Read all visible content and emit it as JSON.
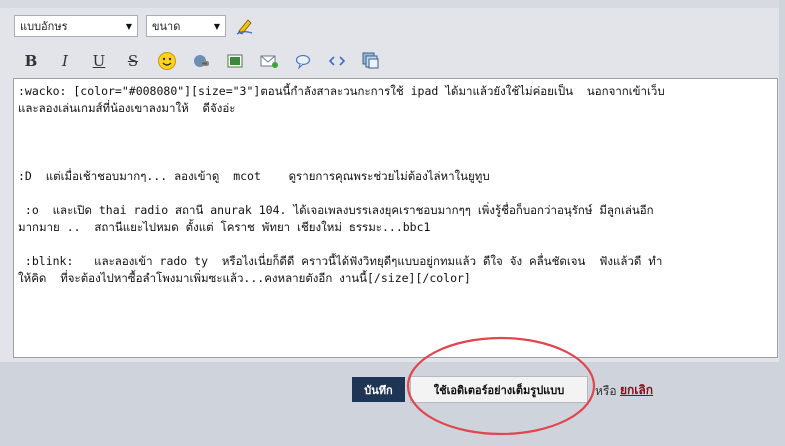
{
  "toolbar": {
    "font_select": "แบบอักษร",
    "size_select": "ขนาด",
    "bold": "B",
    "italic": "I",
    "underline": "U",
    "strike": "S"
  },
  "editor": {
    "lines": [
      ":wacko: [color=\"#008080\"][size=\"3\"]ตอนนี้กำลังสาละวนกะการใช้ ipad ได้มาแล้วยังใช้ไม่ค่อยเป็น  นอกจากเข้าเว็บ",
      "และลองเล่นเกมส์ที่น้องเขาลงมาให้  ดีจังอ่ะ",
      "",
      "",
      "",
      ":D  แต่เมื่อเช้าชอบมากๆ... ลองเข้าดู  mcot    ดูรายการคุณพระช่วยไม่ต้องไล่หาในยูทูบ",
      "",
      " :o  และเปิด thai radio สถานี anurak 104. ได้เจอเพลงบรรเลงยุคเราชอบมากๆๆ เพิ่งรู้ชื่อก็บอกว่าอนุรักษ์ มีลูกเล่นอีก",
      "มากมาย ..  สถานีแยะไปหมด ตั้งแต่ โคราช พัทยา เชียงใหม่ ธรรมะ...bbc1",
      "",
      " :blink:   และลองเข้า rado ty  หรือไงเนี่ยก็ดีดี คราวนี้ได้ฟังวิทยุดีๆแบบอยู่กทมแล้ว ดีใจ จัง คลื่นชัดเจน  ฟังแล้วดี ทำ",
      "ให้คิด  ที่จะต้องไปหาซื้อลำโพงมาเพิ่มซะแล้ว...คงหลายตังอีก งานนี้[/size][/color]"
    ]
  },
  "actions": {
    "save": "บันทึก",
    "full_editor": "ใช้เอดิเตอร์อย่างเต็มรูปแบบ",
    "or": "หรือ",
    "cancel": "ยกเลิก"
  },
  "colors": {
    "save_bg": "#1f3555",
    "cancel_link": "#8b0b1a",
    "highlight_ring": "#e0464f"
  },
  "icons": [
    "pen-icon",
    "smiley-icon",
    "link-icon",
    "image-icon",
    "email-icon",
    "quote-icon",
    "code-icon",
    "gallery-icon"
  ]
}
